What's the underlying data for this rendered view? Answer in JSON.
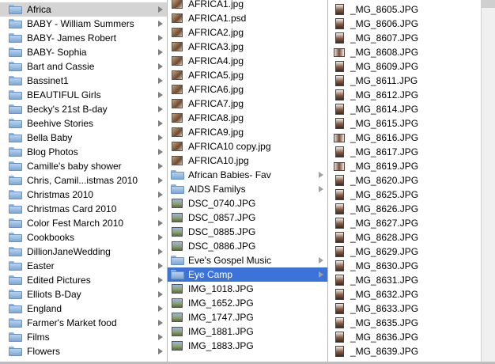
{
  "columns": {
    "folders": [
      {
        "label": "Africa",
        "selected": "grey"
      },
      {
        "label": "BABY - William Summers"
      },
      {
        "label": "BABY- James Robert"
      },
      {
        "label": "BABY- Sophia"
      },
      {
        "label": "Bart and Cassie"
      },
      {
        "label": "Bassinet1"
      },
      {
        "label": "BEAUTIFUL Girls"
      },
      {
        "label": "Becky's 21st B-day"
      },
      {
        "label": "Beehive Stories"
      },
      {
        "label": "Bella Baby"
      },
      {
        "label": "Blog Photos"
      },
      {
        "label": "Camille's baby shower"
      },
      {
        "label": "Chris, Camil...istmas 2010"
      },
      {
        "label": "Christmas 2010"
      },
      {
        "label": "Christmas Card 2010"
      },
      {
        "label": "Color Fest March 2010"
      },
      {
        "label": "Cookbooks"
      },
      {
        "label": "DillionJaneWedding"
      },
      {
        "label": "Easter"
      },
      {
        "label": "Edited Pictures"
      },
      {
        "label": "Elliots B-Day"
      },
      {
        "label": "England"
      },
      {
        "label": "Farmer's Market food"
      },
      {
        "label": "Films"
      },
      {
        "label": "Flowers"
      }
    ],
    "africa": [
      {
        "label": "AFRICA1.jpg",
        "kind": "photo"
      },
      {
        "label": "AFRICA1.psd",
        "kind": "photo"
      },
      {
        "label": "AFRICA2.jpg",
        "kind": "photo"
      },
      {
        "label": "AFRICA3.jpg",
        "kind": "photo"
      },
      {
        "label": "AFRICA4.jpg",
        "kind": "photo"
      },
      {
        "label": "AFRICA5.jpg",
        "kind": "photo"
      },
      {
        "label": "AFRICA6.jpg",
        "kind": "photo"
      },
      {
        "label": "AFRICA7.jpg",
        "kind": "photo"
      },
      {
        "label": "AFRICA8.jpg",
        "kind": "photo"
      },
      {
        "label": "AFRICA9.jpg",
        "kind": "photo"
      },
      {
        "label": "AFRICA10 copy.jpg",
        "kind": "photo"
      },
      {
        "label": "AFRICA10.jpg",
        "kind": "photo"
      },
      {
        "label": "African Babies- Fav",
        "kind": "folder"
      },
      {
        "label": "AIDS Familys",
        "kind": "folder"
      },
      {
        "label": "DSC_0740.JPG",
        "kind": "photo-land"
      },
      {
        "label": "DSC_0857.JPG",
        "kind": "photo-land"
      },
      {
        "label": "DSC_0885.JPG",
        "kind": "photo-land"
      },
      {
        "label": "DSC_0886.JPG",
        "kind": "photo-land"
      },
      {
        "label": "Eve's Gospel Music",
        "kind": "folder"
      },
      {
        "label": "Eye Camp",
        "kind": "folder",
        "selected": "blue"
      },
      {
        "label": "IMG_1018.JPG",
        "kind": "photo-land"
      },
      {
        "label": "IMG_1652.JPG",
        "kind": "photo-land"
      },
      {
        "label": "IMG_1747.JPG",
        "kind": "photo-land"
      },
      {
        "label": "IMG_1881.JPG",
        "kind": "photo-land"
      },
      {
        "label": "IMG_1883.JPG",
        "kind": "photo-land"
      }
    ],
    "eye_camp": [
      {
        "label": "_MG_8605.JPG"
      },
      {
        "label": "_MG_8606.JPG"
      },
      {
        "label": "_MG_8607.JPG"
      },
      {
        "label": "_MG_8608.JPG",
        "orient": "h"
      },
      {
        "label": "_MG_8609.JPG"
      },
      {
        "label": "_MG_8611.JPG"
      },
      {
        "label": "_MG_8612.JPG"
      },
      {
        "label": "_MG_8614.JPG"
      },
      {
        "label": "_MG_8615.JPG"
      },
      {
        "label": "_MG_8616.JPG",
        "orient": "h"
      },
      {
        "label": "_MG_8617.JPG"
      },
      {
        "label": "_MG_8619.JPG",
        "orient": "h"
      },
      {
        "label": "_MG_8620.JPG"
      },
      {
        "label": "_MG_8625.JPG"
      },
      {
        "label": "_MG_8626.JPG"
      },
      {
        "label": "_MG_8627.JPG"
      },
      {
        "label": "_MG_8628.JPG"
      },
      {
        "label": "_MG_8629.JPG"
      },
      {
        "label": "_MG_8630.JPG"
      },
      {
        "label": "_MG_8631.JPG"
      },
      {
        "label": "_MG_8632.JPG"
      },
      {
        "label": "_MG_8633.JPG"
      },
      {
        "label": "_MG_8635.JPG"
      },
      {
        "label": "_MG_8636.JPG"
      },
      {
        "label": "_MG_8639.JPG"
      }
    ]
  },
  "colors": {
    "selection_blue": "#3b73d9",
    "selection_grey": "#d4d4d4",
    "folder_blue": "#8fb5dc"
  }
}
